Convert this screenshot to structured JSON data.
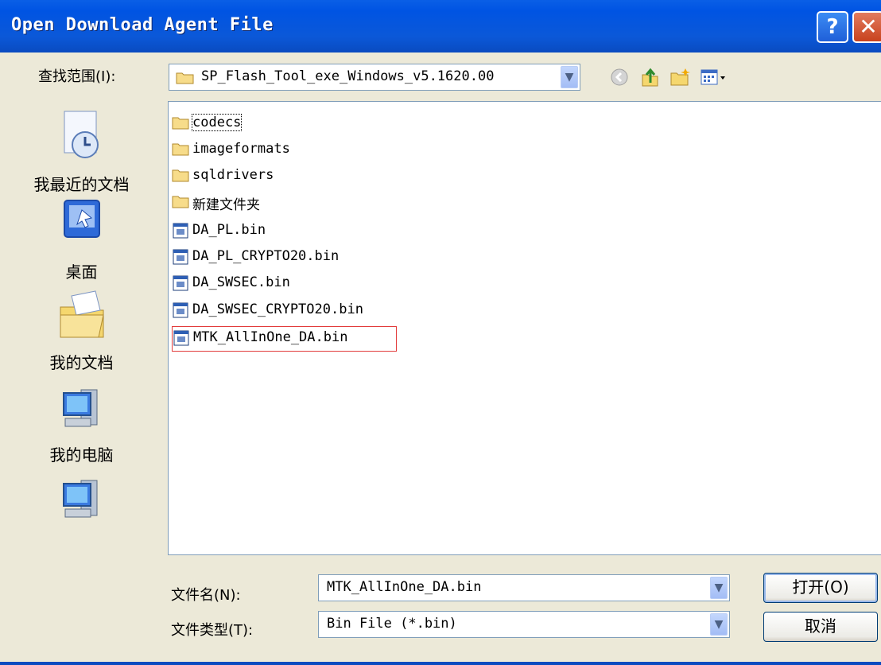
{
  "window": {
    "title": "Open Download Agent File",
    "help_icon": "question-mark-icon",
    "close_icon": "close-icon"
  },
  "lookin": {
    "label": "查找范围(I):",
    "value": "SP_Flash_Tool_exe_Windows_v5.1620.00"
  },
  "toolbar": {
    "icons": [
      "back-icon",
      "up-folder-icon",
      "new-folder-icon",
      "view-menu-icon"
    ]
  },
  "places": [
    {
      "label": "我最近的文档",
      "icon": "recent-documents-icon"
    },
    {
      "label": "桌面",
      "icon": "desktop-icon"
    },
    {
      "label": "我的文档",
      "icon": "my-documents-icon"
    },
    {
      "label": "我的电脑",
      "icon": "my-computer-icon"
    },
    {
      "label": "",
      "icon": "network-places-icon"
    }
  ],
  "files": [
    {
      "name": "codecs",
      "type": "folder"
    },
    {
      "name": "imageformats",
      "type": "folder"
    },
    {
      "name": "sqldrivers",
      "type": "folder"
    },
    {
      "name": "新建文件夹",
      "type": "folder"
    },
    {
      "name": "DA_PL.bin",
      "type": "bin"
    },
    {
      "name": "DA_PL_CRYPTO20.bin",
      "type": "bin"
    },
    {
      "name": "DA_SWSEC.bin",
      "type": "bin"
    },
    {
      "name": "DA_SWSEC_CRYPTO20.bin",
      "type": "bin"
    },
    {
      "name": "MTK_AllInOne_DA.bin",
      "type": "bin",
      "highlighted": true
    }
  ],
  "filename": {
    "label": "文件名(N):",
    "value": "MTK_AllInOne_DA.bin"
  },
  "filetype": {
    "label": "文件类型(T):",
    "value": "Bin File (*.bin)"
  },
  "buttons": {
    "open": "打开(O)",
    "cancel": "取消"
  },
  "colors": {
    "titlebar": "#0054E3",
    "highlight_border": "#E23B3B",
    "dialog_bg": "#ECE9D8"
  }
}
